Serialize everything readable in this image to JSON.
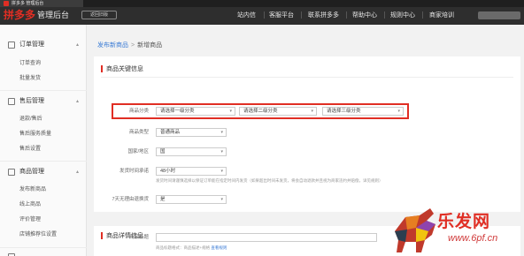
{
  "browser_tab": {
    "title": "拼多多 管理后台"
  },
  "header": {
    "logo_mark": "拼多多",
    "logo_text": "管理后台",
    "old_version_button": "返回旧版",
    "nav": [
      "站内信",
      "客服平台",
      "联系拼多多",
      "帮助中心",
      "规则中心",
      "商家培训"
    ]
  },
  "sidebar": {
    "groups": [
      {
        "title": "订单管理",
        "icon": "clipboard-icon",
        "items": [
          "订单查询",
          "批量发货"
        ]
      },
      {
        "title": "售后管理",
        "icon": "service-icon",
        "items": [
          "退款/售后",
          "售后服务质量",
          "售后设置"
        ]
      },
      {
        "title": "商品管理",
        "icon": "box-icon",
        "items": [
          "发布新商品",
          "线上商品",
          "评价管理",
          "店铺推荐位设置"
        ]
      }
    ]
  },
  "breadcrumb": {
    "parent": "发布新商品",
    "separator": ">",
    "current": "新增商品"
  },
  "section1": {
    "title": "商品关键信息",
    "category": {
      "label": "商品分类",
      "level1": "请选择一级分类",
      "level2": "请选择二级分类",
      "level3": "请选择三级分类"
    },
    "goods_type": {
      "label": "商品类型",
      "value": "普通商品"
    },
    "region": {
      "label": "国家/地区",
      "value": "国"
    },
    "ship_time": {
      "label": "发货时间承诺",
      "value": "48小时",
      "hint": "发货时间请谨慎选择以保证订单能在指定时间内发货（如果超出时间未发货，将会自动退款并且视为商家违约并赔偿，详见规则）"
    },
    "refund": {
      "label": "7天无理由退换货",
      "value": "是"
    }
  },
  "section2": {
    "title": "商品详情信息",
    "goods_name": {
      "label": "商品标题",
      "placeholder": ""
    },
    "hint": "商品标题格式：商品描述+规格",
    "hint_link": "查看规则"
  },
  "watermark": {
    "brand": "乐发网",
    "url": "www.6pf.cn"
  },
  "colors": {
    "accent": "#e02e24",
    "link": "#3a7bd5",
    "topbar": "#2e2e2e"
  }
}
